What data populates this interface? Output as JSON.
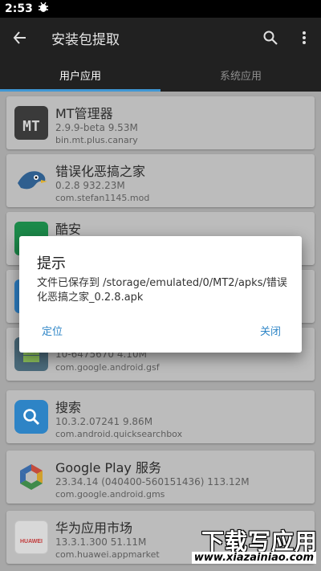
{
  "status_bar": {
    "time": "2:53",
    "notification_icon": "bug-icon"
  },
  "app_bar": {
    "title": "安装包提取",
    "back_icon": "arrow-left-icon",
    "search_icon": "search-icon",
    "more_icon": "more-vertical-icon"
  },
  "tabs": [
    {
      "label": "用户应用",
      "active": true
    },
    {
      "label": "系统应用",
      "active": false
    }
  ],
  "apps": [
    {
      "name": "MT管理器",
      "meta": "2.9.9-beta   9.53M",
      "package": "bin.mt.plus.canary",
      "icon": "mt-manager-icon"
    },
    {
      "name": "错误化恶搞之家",
      "meta": "0.2.8   932.23M",
      "package": "com.stefan1145.mod",
      "icon": "bird-icon"
    },
    {
      "name": "酷安",
      "meta": "",
      "package": "",
      "icon": "coolapk-icon"
    },
    {
      "name": "",
      "meta": "",
      "package": "",
      "icon": "app-icon"
    },
    {
      "name": "",
      "meta": "10-6475670   4.10M",
      "package": "com.google.android.gsf",
      "icon": "android-icon"
    },
    {
      "name": "搜索",
      "meta": "10.3.2.07241   9.86M",
      "package": "com.android.quicksearchbox",
      "icon": "search-app-icon"
    },
    {
      "name": "Google Play 服务",
      "meta": "23.34.14 (040400-560151436)   113.12M",
      "package": "com.google.android.gms",
      "icon": "google-play-services-icon"
    },
    {
      "name": "华为应用市场",
      "meta": "13.3.1.300   51.11M",
      "package": "com.huawei.appmarket",
      "icon": "huawei-appgallery-icon"
    }
  ],
  "huawei_icon_text": "HUAWEI",
  "mt_icon_text": "MT",
  "dialog": {
    "title": "提示",
    "message": "文件已保存到 /storage/emulated/0/MT2/apks/错误化恶搞之家_0.2.8.apk",
    "locate_button": "定位",
    "close_button": "关闭"
  },
  "watermark": {
    "top": "下载写应用",
    "bottom": "www.xiazainiao.com"
  },
  "colors": {
    "accent": "#3f97d4",
    "app_bar": "#212121",
    "dialog_button": "#2f86c7"
  }
}
